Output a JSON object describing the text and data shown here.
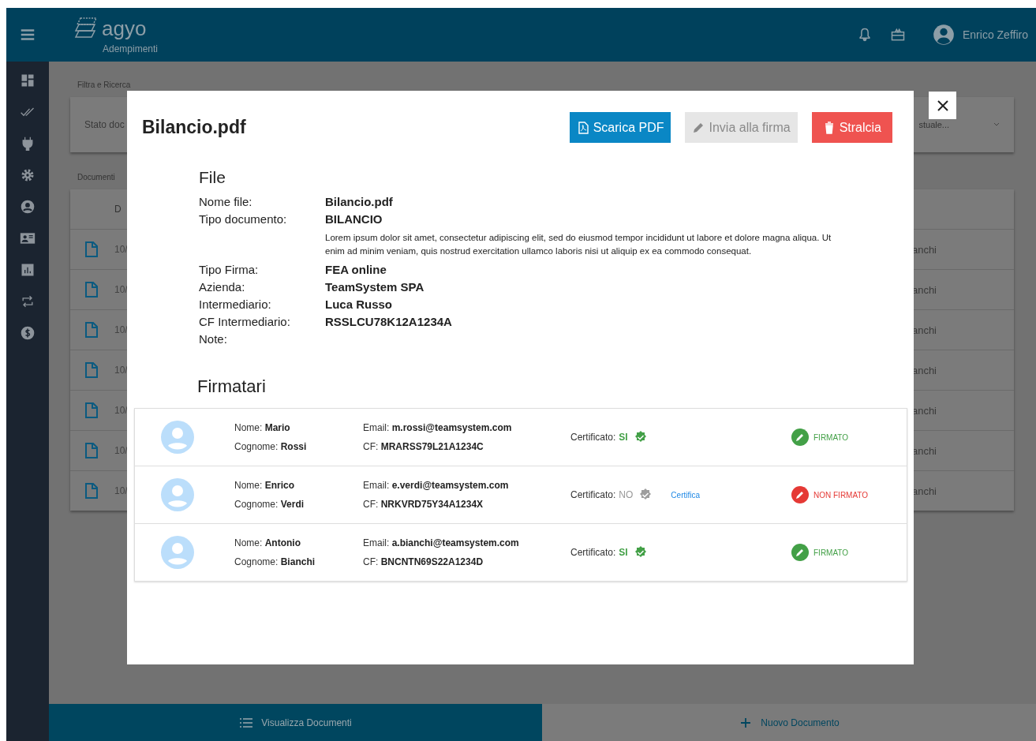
{
  "header": {
    "app_name": "agyo",
    "module": "Adempimenti",
    "user": "Enrico Zeffiro"
  },
  "filters": {
    "title": "Filtra e Ricerca",
    "field_1": "Stato doc",
    "field_2": "stuale..."
  },
  "documents": {
    "title": "Documenti",
    "column_header": "D",
    "rows": [
      {
        "column_1": "10/",
        "column_2": "anchi"
      },
      {
        "column_1": "10/",
        "column_2": "anchi"
      },
      {
        "column_1": "10/",
        "column_2": "anchi"
      },
      {
        "column_1": "10/",
        "column_2": "anchi"
      },
      {
        "column_1": "10/",
        "column_2": "anchi"
      },
      {
        "column_1": "10/",
        "column_2": "anchi"
      },
      {
        "column_1": "10/",
        "column_2": "anchi"
      }
    ]
  },
  "modal": {
    "title": "Bilancio.pdf",
    "buttons": [
      {
        "kind": "download",
        "label": "Scarica PDF",
        "disabled": false
      },
      {
        "kind": "sign",
        "label": "Invia alla firma",
        "disabled": true
      },
      {
        "kind": "delete",
        "label": "Stralcia",
        "disabled": false
      }
    ],
    "file": {
      "title": "File",
      "fields": [
        {
          "label": "Nome file:",
          "value": "Bilancio.pdf"
        },
        {
          "label": "Tipo documento:",
          "value": "BILANCIO",
          "description": "Lorem ipsum dolor sit amet, consectetur adipiscing elit, sed do eiusmod tempor incididunt ut labore et dolore magna aliqua. Ut enim ad minim veniam, quis nostrud exercitation ullamco laboris nisi ut aliquip ex ea commodo consequat."
        },
        {
          "label": "Tipo Firma:",
          "value": "FEA online"
        },
        {
          "label": "Azienda:",
          "value": "TeamSystem SPA"
        },
        {
          "label": "Intermediario:",
          "value": "Luca Russo"
        },
        {
          "label": "CF Intermediario:",
          "value": "RSSLCU78K12A1234A"
        },
        {
          "label": "Note:"
        }
      ]
    },
    "signers": {
      "title": "Firmatari",
      "rows": [
        {
          "name_label": "Nome:",
          "name": "Mario",
          "surname_label": "Cognome:",
          "surname": "Rossi",
          "email_label": "Email:",
          "email": "m.rossi@teamsystem.com",
          "cf_label": "CF:",
          "cf": "MRARSS79L21A1234C",
          "certificate_label": "Certificato:",
          "certificate": "SI",
          "certified": true,
          "status": "FIRMATO",
          "signed": true
        },
        {
          "name_label": "Nome:",
          "name": "Enrico",
          "surname_label": "Cognome:",
          "surname": "Verdi",
          "email_label": "Email:",
          "email": "e.verdi@teamsystem.com",
          "cf_label": "CF:",
          "cf": "NRKVRD75Y34A1234X",
          "certificate_label": "Certificato:",
          "certificate": "NO",
          "certified": false,
          "certify_link": "Certifica",
          "status": "NON FIRMATO",
          "signed": false
        },
        {
          "name_label": "Nome:",
          "name": "Antonio",
          "surname_label": "Cognome:",
          "surname": "Bianchi",
          "email_label": "Email:",
          "email": "a.bianchi@teamsystem.com",
          "cf_label": "CF:",
          "cf": "BNCNTN69S22A1234D",
          "certificate_label": "Certificato:",
          "certificate": "SI",
          "certified": true,
          "status": "FIRMATO",
          "signed": true
        }
      ]
    }
  },
  "bottom_tabs": [
    {
      "kind": "list",
      "label": "Visualizza Documenti",
      "selected": true
    },
    {
      "kind": "add",
      "label": "Nuovo Documento",
      "selected": false
    }
  ]
}
